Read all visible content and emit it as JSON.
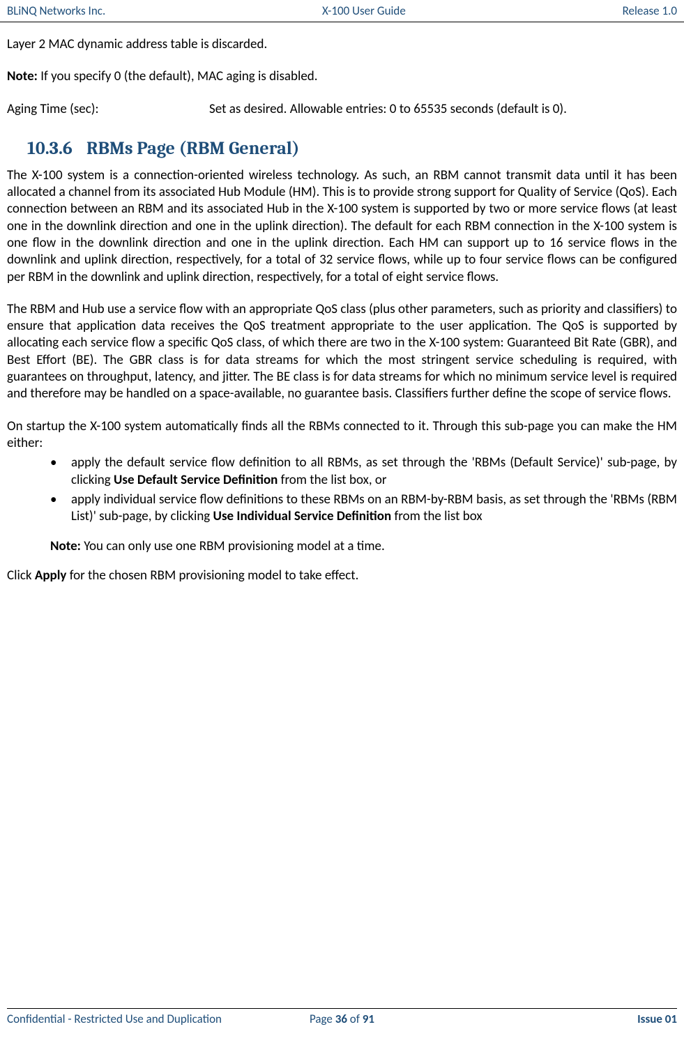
{
  "header": {
    "left": "BLiNQ Networks Inc.",
    "center": "X-100 User Guide",
    "right": "Release 1.0"
  },
  "content": {
    "intro": "Layer 2 MAC dynamic address table is discarded.",
    "note1_label": "Note:",
    "note1_text": " If you specify 0 (the default), MAC aging is disabled.",
    "field": {
      "label": "Aging Time (sec):",
      "value": "Set as desired. Allowable entries: 0 to 65535 seconds (default is 0)."
    },
    "section": {
      "number": "10.3.6",
      "title": "RBMs Page (RBM General)"
    },
    "p1": "The X-100 system is a connection-oriented wireless technology. As such, an RBM cannot transmit data until it has been allocated a channel from its associated Hub Module (HM). This is to provide strong support for Quality of Service (QoS). Each connection between an RBM and its associated Hub in the X-100 system is supported by two or more service flows (at least one in the downlink direction and one in the uplink direction). The default for each RBM connection in the X-100 system is one flow in the downlink direction and one in the uplink direction. Each HM can support up to 16 service flows in the downlink and uplink direction, respectively, for a total of 32 service flows, while up to four service flows can be configured per RBM in the downlink and uplink direction, respectively, for a total of eight service flows.",
    "p2": "The RBM and Hub use a service flow with an appropriate QoS class (plus other parameters, such as priority and classifiers) to ensure that application data receives the QoS treatment appropriate to the user application. The QoS is supported by allocating each service flow a specific QoS class, of which there are two in the X-100 system: Guaranteed Bit Rate (GBR), and Best Effort (BE). The GBR class is for data streams for which the most stringent service scheduling is required, with guarantees on throughput, latency, and jitter. The BE class is for data streams for which no minimum service level is required and therefore may be handled on a space-available, no guarantee basis. Classifiers further define the scope of service flows.",
    "p3": "On startup the X-100 system automatically finds all the RBMs connected to it. Through this sub-page you can make the HM either:",
    "bullets": [
      {
        "pre": "apply the default service flow definition to all RBMs, as set through the 'RBMs (Default Service)' sub-page, by clicking ",
        "bold": "Use Default Service Definition",
        "post": " from the list box, or"
      },
      {
        "pre": "apply individual service flow definitions to these RBMs on an RBM-by-RBM basis, as set through the 'RBMs (RBM List)' sub-page, by clicking ",
        "bold": "Use Individual Service Definition",
        "post": " from the list box"
      }
    ],
    "note2_label": "Note:",
    "note2_text": " You can only use one RBM provisioning model at a time.",
    "final_pre": "Click ",
    "final_bold": "Apply",
    "final_post": " for the chosen RBM provisioning model to take effect."
  },
  "footer": {
    "left": "Confidential - Restricted Use and Duplication",
    "page_pre": "Page ",
    "page_num": "36",
    "page_mid": " of ",
    "page_total": "91",
    "right": "Issue 01"
  }
}
